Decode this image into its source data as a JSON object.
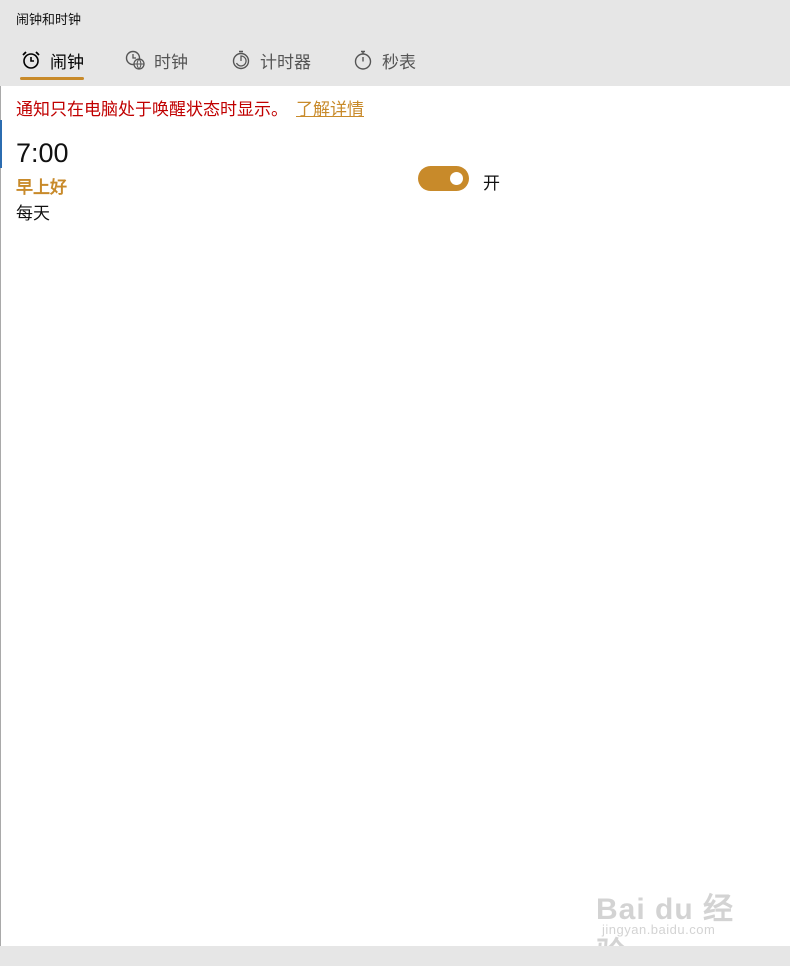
{
  "window": {
    "title": "闹钟和时钟"
  },
  "tabs": [
    {
      "label": "闹钟",
      "icon": "alarm-clock-icon",
      "active": true
    },
    {
      "label": "时钟",
      "icon": "world-clock-icon",
      "active": false
    },
    {
      "label": "计时器",
      "icon": "timer-icon",
      "active": false
    },
    {
      "label": "秒表",
      "icon": "stopwatch-icon",
      "active": false
    }
  ],
  "notice": {
    "text": "通知只在电脑处于唤醒状态时显示。",
    "link": "了解详情"
  },
  "alarm": {
    "time": "7:00",
    "name": "早上好",
    "repeat": "每天",
    "toggle_label": "开",
    "enabled": true
  },
  "watermark": {
    "text": "Bai du 经验",
    "url": "jingyan.baidu.com"
  },
  "colors": {
    "accent": "#c88a2a",
    "notice": "#c00000",
    "chrome": "#e6e6e6"
  }
}
